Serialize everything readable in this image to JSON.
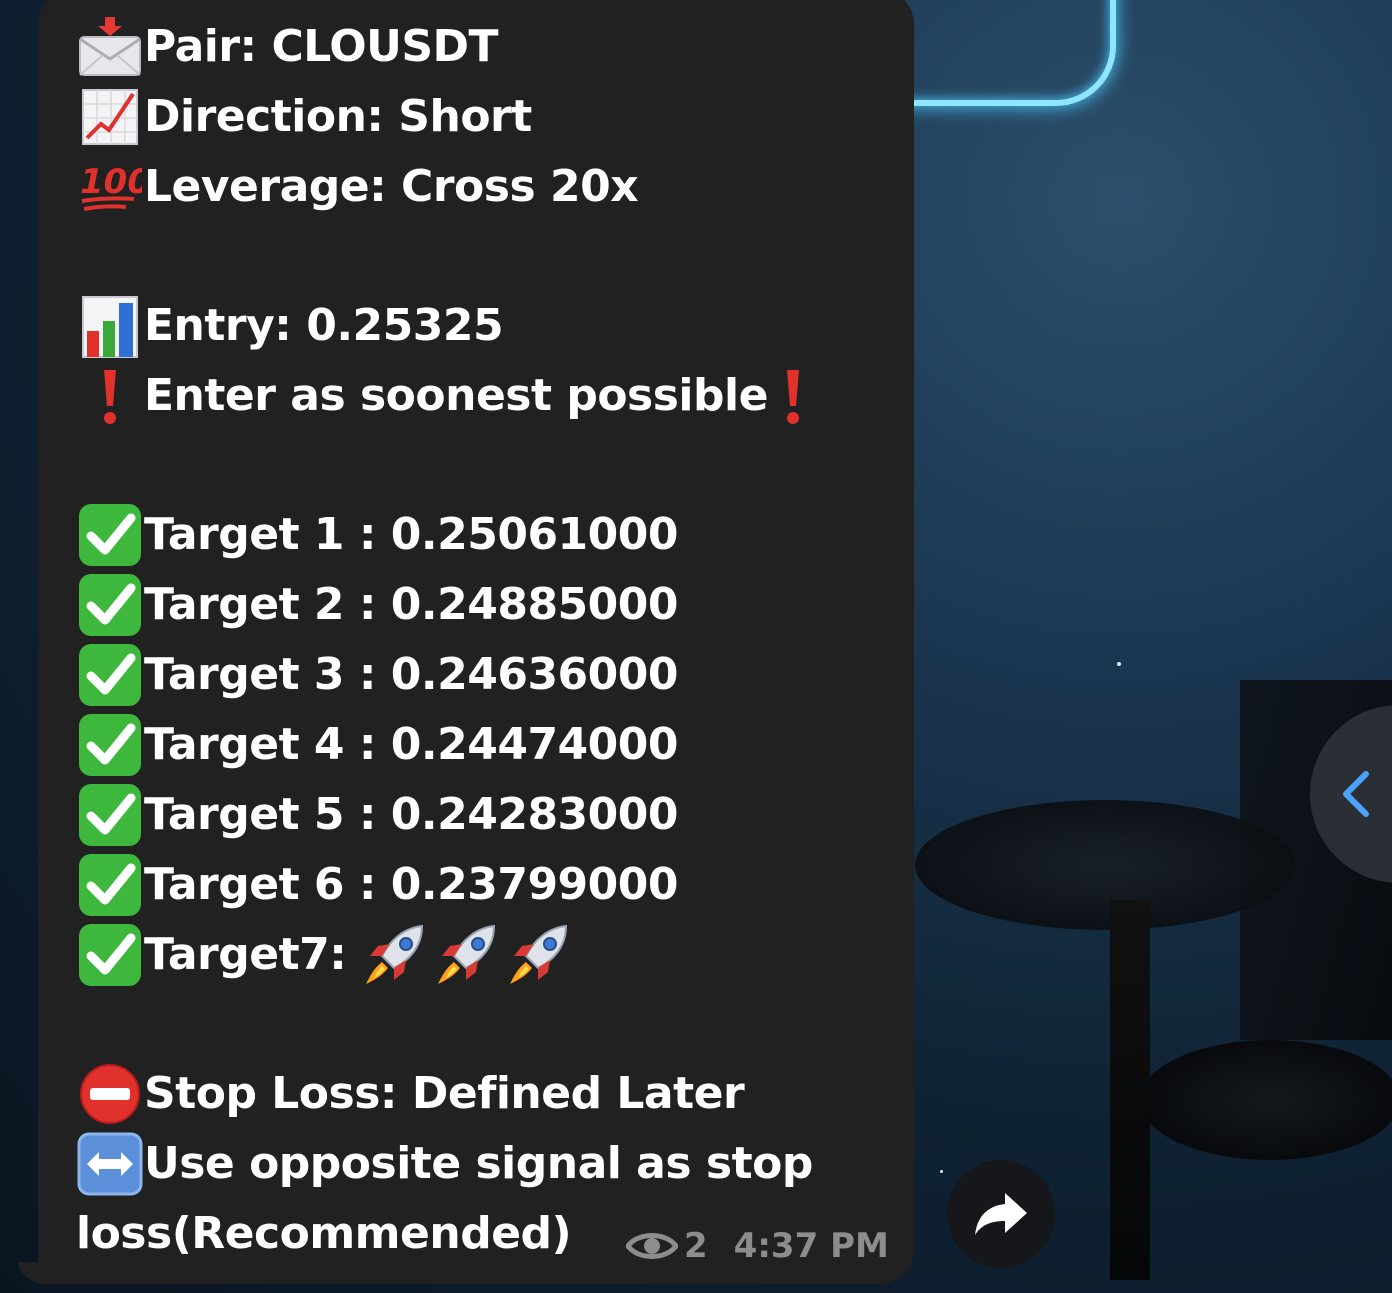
{
  "message": {
    "lines": [
      {
        "icon": "incoming-envelope-icon",
        "text": "Pair: CLOUSDT"
      },
      {
        "icon": "chart-increasing-icon",
        "text": "Direction: Short"
      },
      {
        "icon": "hundred-points-icon",
        "text": "Leverage: Cross 20x"
      },
      {
        "icon": "bar-chart-icon",
        "text": "Entry: 0.25325"
      },
      {
        "icon": "exclamation-mark-icon",
        "text": "Enter as soonest possible"
      },
      {
        "icon": "check-mark-button-icon",
        "text": "Target 1 : 0.25061000"
      },
      {
        "icon": "check-mark-button-icon",
        "text": "Target 2 : 0.24885000"
      },
      {
        "icon": "check-mark-button-icon",
        "text": "Target 3 : 0.24636000"
      },
      {
        "icon": "check-mark-button-icon",
        "text": "Target 4 : 0.24474000"
      },
      {
        "icon": "check-mark-button-icon",
        "text": "Target 5 : 0.24283000"
      },
      {
        "icon": "check-mark-button-icon",
        "text": "Target 6 : 0.23799000"
      },
      {
        "icon": "check-mark-button-icon",
        "text": "Target7:"
      },
      {
        "icon": "no-entry-icon",
        "text": "Stop Loss: Defined Later"
      },
      {
        "icon": "left-right-arrow-icon",
        "text": "Use opposite signal as stop"
      },
      {
        "icon": "",
        "text": "loss(Recommended)"
      }
    ]
  },
  "meta": {
    "views": "2",
    "time": "4:37 PM"
  },
  "colors": {
    "bubble": "#212121",
    "text": "#ffffff",
    "meta": "#8d8d8d",
    "check": "#3db83d",
    "accent_blue": "#4ba3ff"
  }
}
